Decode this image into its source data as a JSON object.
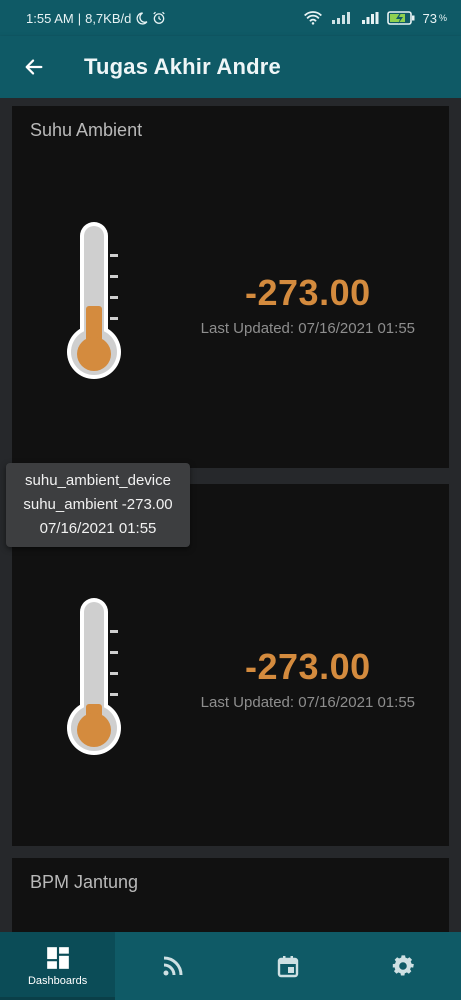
{
  "status_bar": {
    "time": "1:55 AM",
    "network_speed": "8,7KB/d",
    "battery_percent": "73"
  },
  "app_bar": {
    "title": "Tugas Akhir Andre"
  },
  "widgets": [
    {
      "title": "Suhu Ambient",
      "value": "-273.00",
      "updated": "Last Updated: 07/16/2021 01:55"
    },
    {
      "title": "",
      "value": "-273.00",
      "updated": "Last Updated: 07/16/2021 01:55"
    },
    {
      "title": "BPM Jantung"
    }
  ],
  "tooltip": {
    "line1": "suhu_ambient_device",
    "line2": "suhu_ambient -273.00",
    "line3": "07/16/2021 01:55"
  },
  "bottom_nav": {
    "items": [
      {
        "label": "Dashboards",
        "icon": "dashboard-icon"
      },
      {
        "label": "",
        "icon": "rss-feed-icon"
      },
      {
        "label": "",
        "icon": "calendar-event-icon"
      },
      {
        "label": "",
        "icon": "gear-icon"
      }
    ]
  },
  "colors": {
    "primary": "#0f5a66",
    "accent_orange": "#d48b3e",
    "widget_bg": "#111111"
  }
}
